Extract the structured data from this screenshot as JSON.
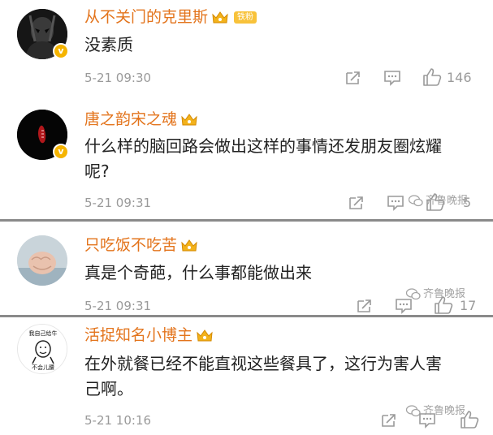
{
  "comments": [
    {
      "username": "从不关门的克里斯",
      "fan_badge": "铁粉",
      "text": "没素质",
      "time": "5-21 09:30",
      "like_count": "146",
      "avatar": "dark-hooded-figure"
    },
    {
      "username": "唐之韵宋之魂",
      "text_line1": "什么样的脑回路会做出这样的事情还发朋友圈炫耀",
      "text_line2": "呢?",
      "time": "5-21 09:31",
      "like_count": "5",
      "avatar": "black-with-red-mark"
    },
    {
      "username": "只吃饭不吃苦",
      "text": "真是个奇葩，什么事都能做出来",
      "time": "5-21 09:31",
      "like_count": "17",
      "avatar": "fist-photo"
    },
    {
      "username": "活捉知名小博主",
      "text_line1": "在外就餐已经不能直视这些餐具了，这行为害人害",
      "text_line2": "己啊。",
      "time": "5-21 10:16",
      "avatar": "meme-face",
      "avatar_caption_top": "我自己给牛",
      "avatar_caption_bottom": "不会儿腰"
    }
  ],
  "watermark": "齐鲁晚报",
  "colors": {
    "username": "#e3741c",
    "crown": "#f3b21b",
    "badge": "#f8c23a",
    "meta": "#9a9a9a",
    "separator": "#8a8a8a"
  },
  "icons": [
    "verified-v-icon",
    "crown-icon",
    "share-icon",
    "comment-icon",
    "like-icon",
    "wechat-icon"
  ]
}
